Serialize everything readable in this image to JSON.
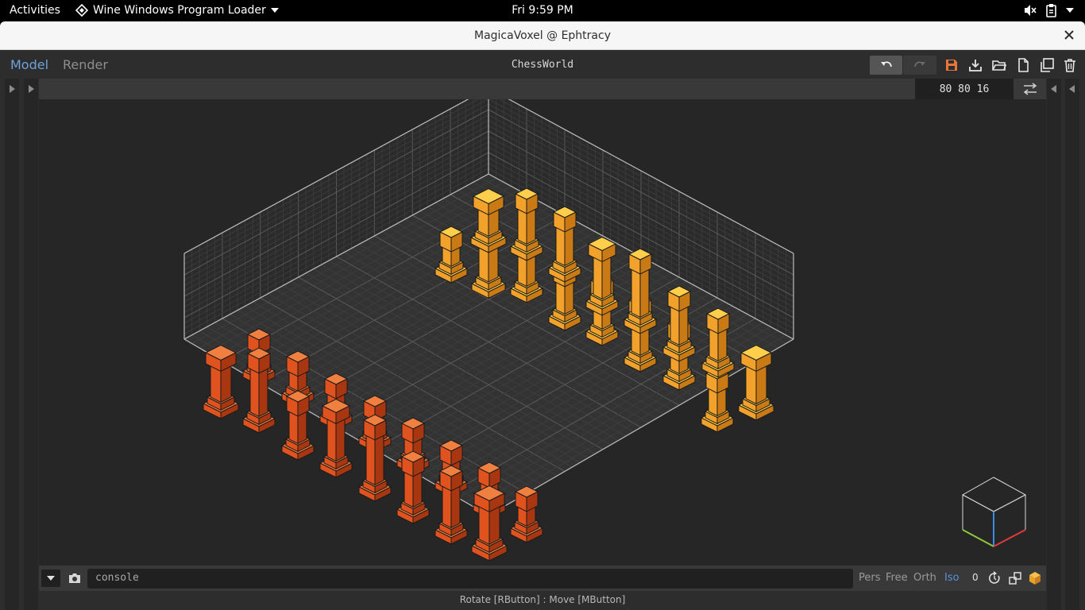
{
  "topbar": {
    "activities": "Activities",
    "app_menu": "Wine Windows Program Loader",
    "clock": "Fri  9:59 PM"
  },
  "window": {
    "title": "MagicaVoxel @ Ephtracy"
  },
  "toolbar": {
    "mode_model": "Model",
    "mode_render": "Render",
    "file_name": "ChessWorld"
  },
  "model_size": "80  80  16",
  "console": {
    "placeholder": "console"
  },
  "view_modes": [
    "Pers",
    "Free",
    "Orth",
    "Iso"
  ],
  "active_view_mode": "Iso",
  "counter": "0",
  "status_text": "Rotate [RButton] : Move [MButton]",
  "colors": {
    "accent": "#5b8fd8",
    "save_icon": "#e8753a",
    "voxel_orange": "#f2a22a",
    "voxel_red": "#e0531f"
  },
  "icons": {
    "undo": "undo-icon",
    "redo": "redo-icon",
    "save": "save-icon",
    "export": "download-icon",
    "open": "folder-open-icon",
    "new": "new-file-icon",
    "copy": "copy-icon",
    "delete": "trash-icon",
    "swap": "swap-icon",
    "camera": "camera-icon",
    "reset": "reset-icon",
    "frame": "frame-icon",
    "box": "box-icon"
  }
}
